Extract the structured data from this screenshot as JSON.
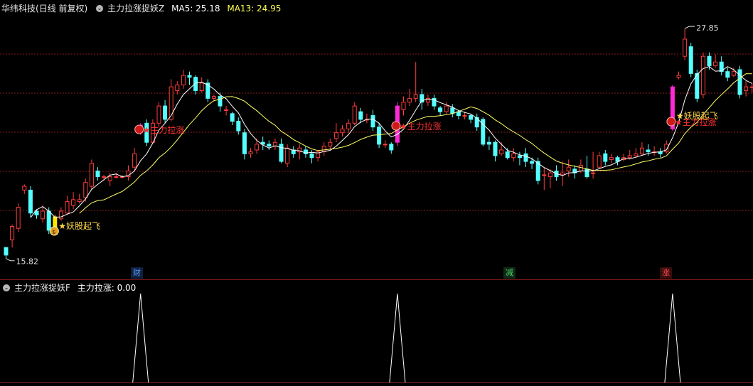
{
  "header": {
    "stock": "华纬科技",
    "period": "(日线 前复权)",
    "indicator": "主力拉涨捉妖Z",
    "ma5_label": "MA5: 25.18",
    "ma13_label": "MA13: 24.95"
  },
  "sub_header": {
    "indicator": "主力拉涨捉妖F",
    "value_label": "主力拉涨: 0.00"
  },
  "tags": [
    "财",
    "减",
    "涨"
  ],
  "colors": {
    "bg": "#000000",
    "up": "#ff3c3c",
    "down": "#54ffff",
    "ma5": "#ffffff",
    "ma13": "#ffff66",
    "grid": "#8a1c1c",
    "magenta": "#ff2ad4",
    "yellow_bar": "#ffe600",
    "signal_text": "#ff3030",
    "star_text": "#ffd84a"
  },
  "chart_data": {
    "type": "candlestick",
    "price_high_label": "27.85",
    "price_low_label": "15.82",
    "ylim": [
      15.4,
      28.6
    ],
    "signals_lala": "主力拉涨",
    "signals_yao": "妖股起飞",
    "signal_lala_indices": [
      22,
      64,
      109
    ],
    "signal_yao_indices": [
      8,
      109
    ],
    "candles": [
      [
        16.4,
        16.0,
        16.2,
        15.8
      ],
      [
        16.8,
        17.5,
        17.6,
        16.4
      ],
      [
        17.4,
        18.5,
        18.7,
        17.2
      ],
      [
        19.4,
        19.6,
        19.7,
        19.2
      ],
      [
        19.4,
        18.2,
        19.6,
        18.0
      ],
      [
        18.3,
        18.1,
        18.4,
        17.9
      ],
      [
        17.9,
        18.3,
        18.6,
        17.7
      ],
      [
        18.3,
        17.3,
        18.5,
        17.1
      ],
      [
        17.3,
        18.0,
        18.1,
        17.1
      ],
      [
        17.9,
        18.3,
        18.5,
        17.8
      ],
      [
        18.2,
        18.8,
        19.1,
        18.1
      ],
      [
        18.6,
        18.9,
        19.3,
        18.4
      ],
      [
        18.8,
        18.9,
        19.2,
        18.7
      ],
      [
        19.0,
        19.8,
        20.0,
        18.8
      ],
      [
        19.6,
        20.8,
        21.0,
        19.4
      ],
      [
        20.4,
        20.1,
        20.6,
        19.9
      ],
      [
        20.1,
        20.1,
        20.2,
        19.9
      ],
      [
        19.9,
        20.1,
        20.3,
        19.6
      ],
      [
        20.1,
        20.1,
        20.3,
        20.0
      ],
      [
        20.1,
        20.1,
        20.2,
        20.0
      ],
      [
        20.1,
        20.4,
        20.7,
        19.9
      ],
      [
        20.6,
        21.3,
        21.6,
        20.4
      ],
      [
        22.4,
        22.8,
        22.9,
        22.3
      ],
      [
        22.9,
        21.9,
        23.1,
        21.7
      ],
      [
        21.9,
        22.9,
        23.1,
        21.8
      ],
      [
        22.9,
        23.8,
        24.0,
        22.7
      ],
      [
        23.8,
        23.1,
        24.1,
        22.9
      ],
      [
        23.1,
        24.8,
        25.2,
        23.0
      ],
      [
        24.6,
        24.9,
        25.1,
        24.4
      ],
      [
        24.9,
        25.4,
        25.7,
        24.7
      ],
      [
        25.4,
        25.3,
        25.6,
        24.9
      ],
      [
        25.3,
        24.6,
        25.4,
        24.4
      ],
      [
        24.6,
        25.0,
        25.3,
        24.5
      ],
      [
        25.0,
        24.2,
        25.2,
        24.0
      ],
      [
        24.2,
        24.3,
        24.4,
        24.1
      ],
      [
        24.3,
        23.8,
        24.5,
        23.5
      ],
      [
        23.6,
        23.6,
        23.8,
        23.3
      ],
      [
        23.4,
        23.0,
        23.5,
        22.8
      ],
      [
        23.0,
        22.5,
        23.2,
        22.3
      ],
      [
        22.4,
        21.3,
        22.6,
        21.0
      ],
      [
        21.3,
        21.4,
        21.6,
        21.1
      ],
      [
        21.5,
        21.8,
        22.1,
        21.3
      ],
      [
        21.9,
        21.8,
        22.2,
        21.5
      ],
      [
        21.8,
        21.7,
        22.0,
        21.5
      ],
      [
        21.7,
        21.9,
        22.1,
        21.5
      ],
      [
        21.8,
        20.9,
        22.1,
        20.8
      ],
      [
        20.8,
        21.6,
        21.8,
        20.6
      ],
      [
        21.5,
        21.3,
        21.7,
        21.1
      ],
      [
        21.4,
        21.6,
        21.8,
        21.0
      ],
      [
        21.5,
        21.3,
        21.7,
        21.1
      ],
      [
        21.3,
        21.1,
        21.5,
        20.8
      ],
      [
        21.1,
        21.4,
        21.5,
        20.9
      ],
      [
        21.4,
        21.7,
        21.9,
        21.2
      ],
      [
        21.7,
        21.9,
        22.1,
        21.5
      ],
      [
        22.1,
        22.4,
        22.9,
        21.9
      ],
      [
        22.4,
        22.6,
        22.8,
        22.2
      ],
      [
        22.6,
        22.9,
        23.1,
        22.4
      ],
      [
        22.9,
        23.8,
        24.0,
        22.8
      ],
      [
        23.5,
        23.1,
        23.7,
        22.9
      ],
      [
        23.1,
        23.1,
        23.4,
        22.9
      ],
      [
        23.3,
        22.7,
        23.6,
        22.5
      ],
      [
        22.7,
        21.8,
        22.9,
        21.6
      ],
      [
        21.8,
        21.8,
        22.0,
        21.6
      ],
      [
        21.8,
        21.5,
        21.9,
        21.3
      ],
      [
        21.9,
        23.8,
        24.0,
        21.7
      ],
      [
        23.6,
        24.0,
        24.3,
        23.3
      ],
      [
        24.0,
        24.2,
        24.7,
        23.8
      ],
      [
        24.2,
        24.4,
        26.1,
        24.0
      ],
      [
        24.4,
        24.0,
        24.7,
        23.6
      ],
      [
        24.0,
        24.2,
        24.4,
        23.8
      ],
      [
        24.2,
        23.8,
        24.4,
        23.6
      ],
      [
        23.7,
        23.5,
        23.8,
        23.3
      ],
      [
        23.5,
        23.8,
        24.0,
        23.4
      ],
      [
        23.7,
        23.4,
        23.9,
        23.2
      ],
      [
        23.5,
        23.3,
        23.6,
        23.1
      ],
      [
        23.3,
        23.3,
        23.5,
        23.1
      ],
      [
        23.3,
        23.1,
        23.4,
        22.9
      ],
      [
        23.2,
        22.7,
        23.4,
        22.5
      ],
      [
        23.1,
        21.8,
        23.2,
        21.7
      ],
      [
        21.9,
        21.8,
        22.2,
        21.5
      ],
      [
        21.9,
        21.2,
        22.0,
        20.9
      ],
      [
        21.3,
        21.5,
        21.9,
        21.2
      ],
      [
        21.4,
        21.1,
        21.6,
        21.0
      ],
      [
        21.1,
        21.3,
        21.6,
        20.9
      ],
      [
        21.2,
        21.1,
        21.4,
        20.7
      ],
      [
        21.3,
        20.9,
        21.6,
        20.6
      ],
      [
        20.9,
        20.8,
        21.1,
        20.5
      ],
      [
        20.9,
        19.9,
        21.1,
        19.7
      ],
      [
        20.2,
        20.2,
        20.6,
        19.4
      ],
      [
        20.1,
        20.3,
        20.5,
        19.5
      ],
      [
        20.4,
        20.1,
        20.7,
        19.9
      ],
      [
        20.2,
        20.3,
        20.9,
        19.6
      ],
      [
        20.4,
        20.6,
        21.0,
        20.1
      ],
      [
        20.5,
        20.3,
        20.7,
        20.0
      ],
      [
        20.4,
        20.7,
        21.0,
        20.3
      ],
      [
        20.5,
        20.1,
        21.2,
        20.0
      ],
      [
        20.3,
        20.3,
        21.4,
        20.0
      ],
      [
        20.6,
        21.2,
        21.4,
        20.5
      ],
      [
        21.3,
        20.9,
        21.5,
        20.7
      ],
      [
        21.0,
        21.1,
        21.3,
        20.8
      ],
      [
        21.1,
        20.9,
        21.2,
        20.7
      ],
      [
        21.0,
        21.1,
        21.3,
        20.9
      ],
      [
        21.1,
        21.2,
        21.5,
        21.0
      ],
      [
        21.2,
        21.3,
        21.6,
        21.1
      ],
      [
        21.3,
        21.6,
        21.9,
        21.2
      ],
      [
        21.5,
        21.4,
        21.8,
        21.2
      ],
      [
        21.4,
        21.4,
        21.7,
        21.2
      ],
      [
        21.4,
        21.3,
        21.6,
        21.1
      ],
      [
        21.4,
        21.8,
        22.0,
        21.3
      ],
      [
        22.6,
        24.8,
        24.9,
        22.5
      ],
      [
        25.3,
        25.4,
        25.6,
        25.2
      ],
      [
        26.4,
        27.3,
        27.85,
        26.2
      ],
      [
        26.9,
        25.5,
        27.1,
        25.3
      ],
      [
        25.5,
        24.2,
        25.7,
        24.0
      ],
      [
        24.4,
        26.4,
        26.6,
        24.2
      ],
      [
        26.4,
        25.9,
        26.6,
        25.7
      ],
      [
        25.9,
        26.1,
        26.5,
        25.8
      ],
      [
        26.1,
        25.6,
        26.4,
        25.4
      ],
      [
        25.6,
        25.3,
        25.8,
        25.1
      ],
      [
        25.4,
        25.6,
        25.8,
        25.3
      ],
      [
        25.7,
        24.4,
        25.9,
        24.2
      ],
      [
        24.6,
        24.8,
        25.1,
        24.3
      ],
      [
        24.8,
        24.8,
        25.0,
        24.5
      ]
    ]
  }
}
